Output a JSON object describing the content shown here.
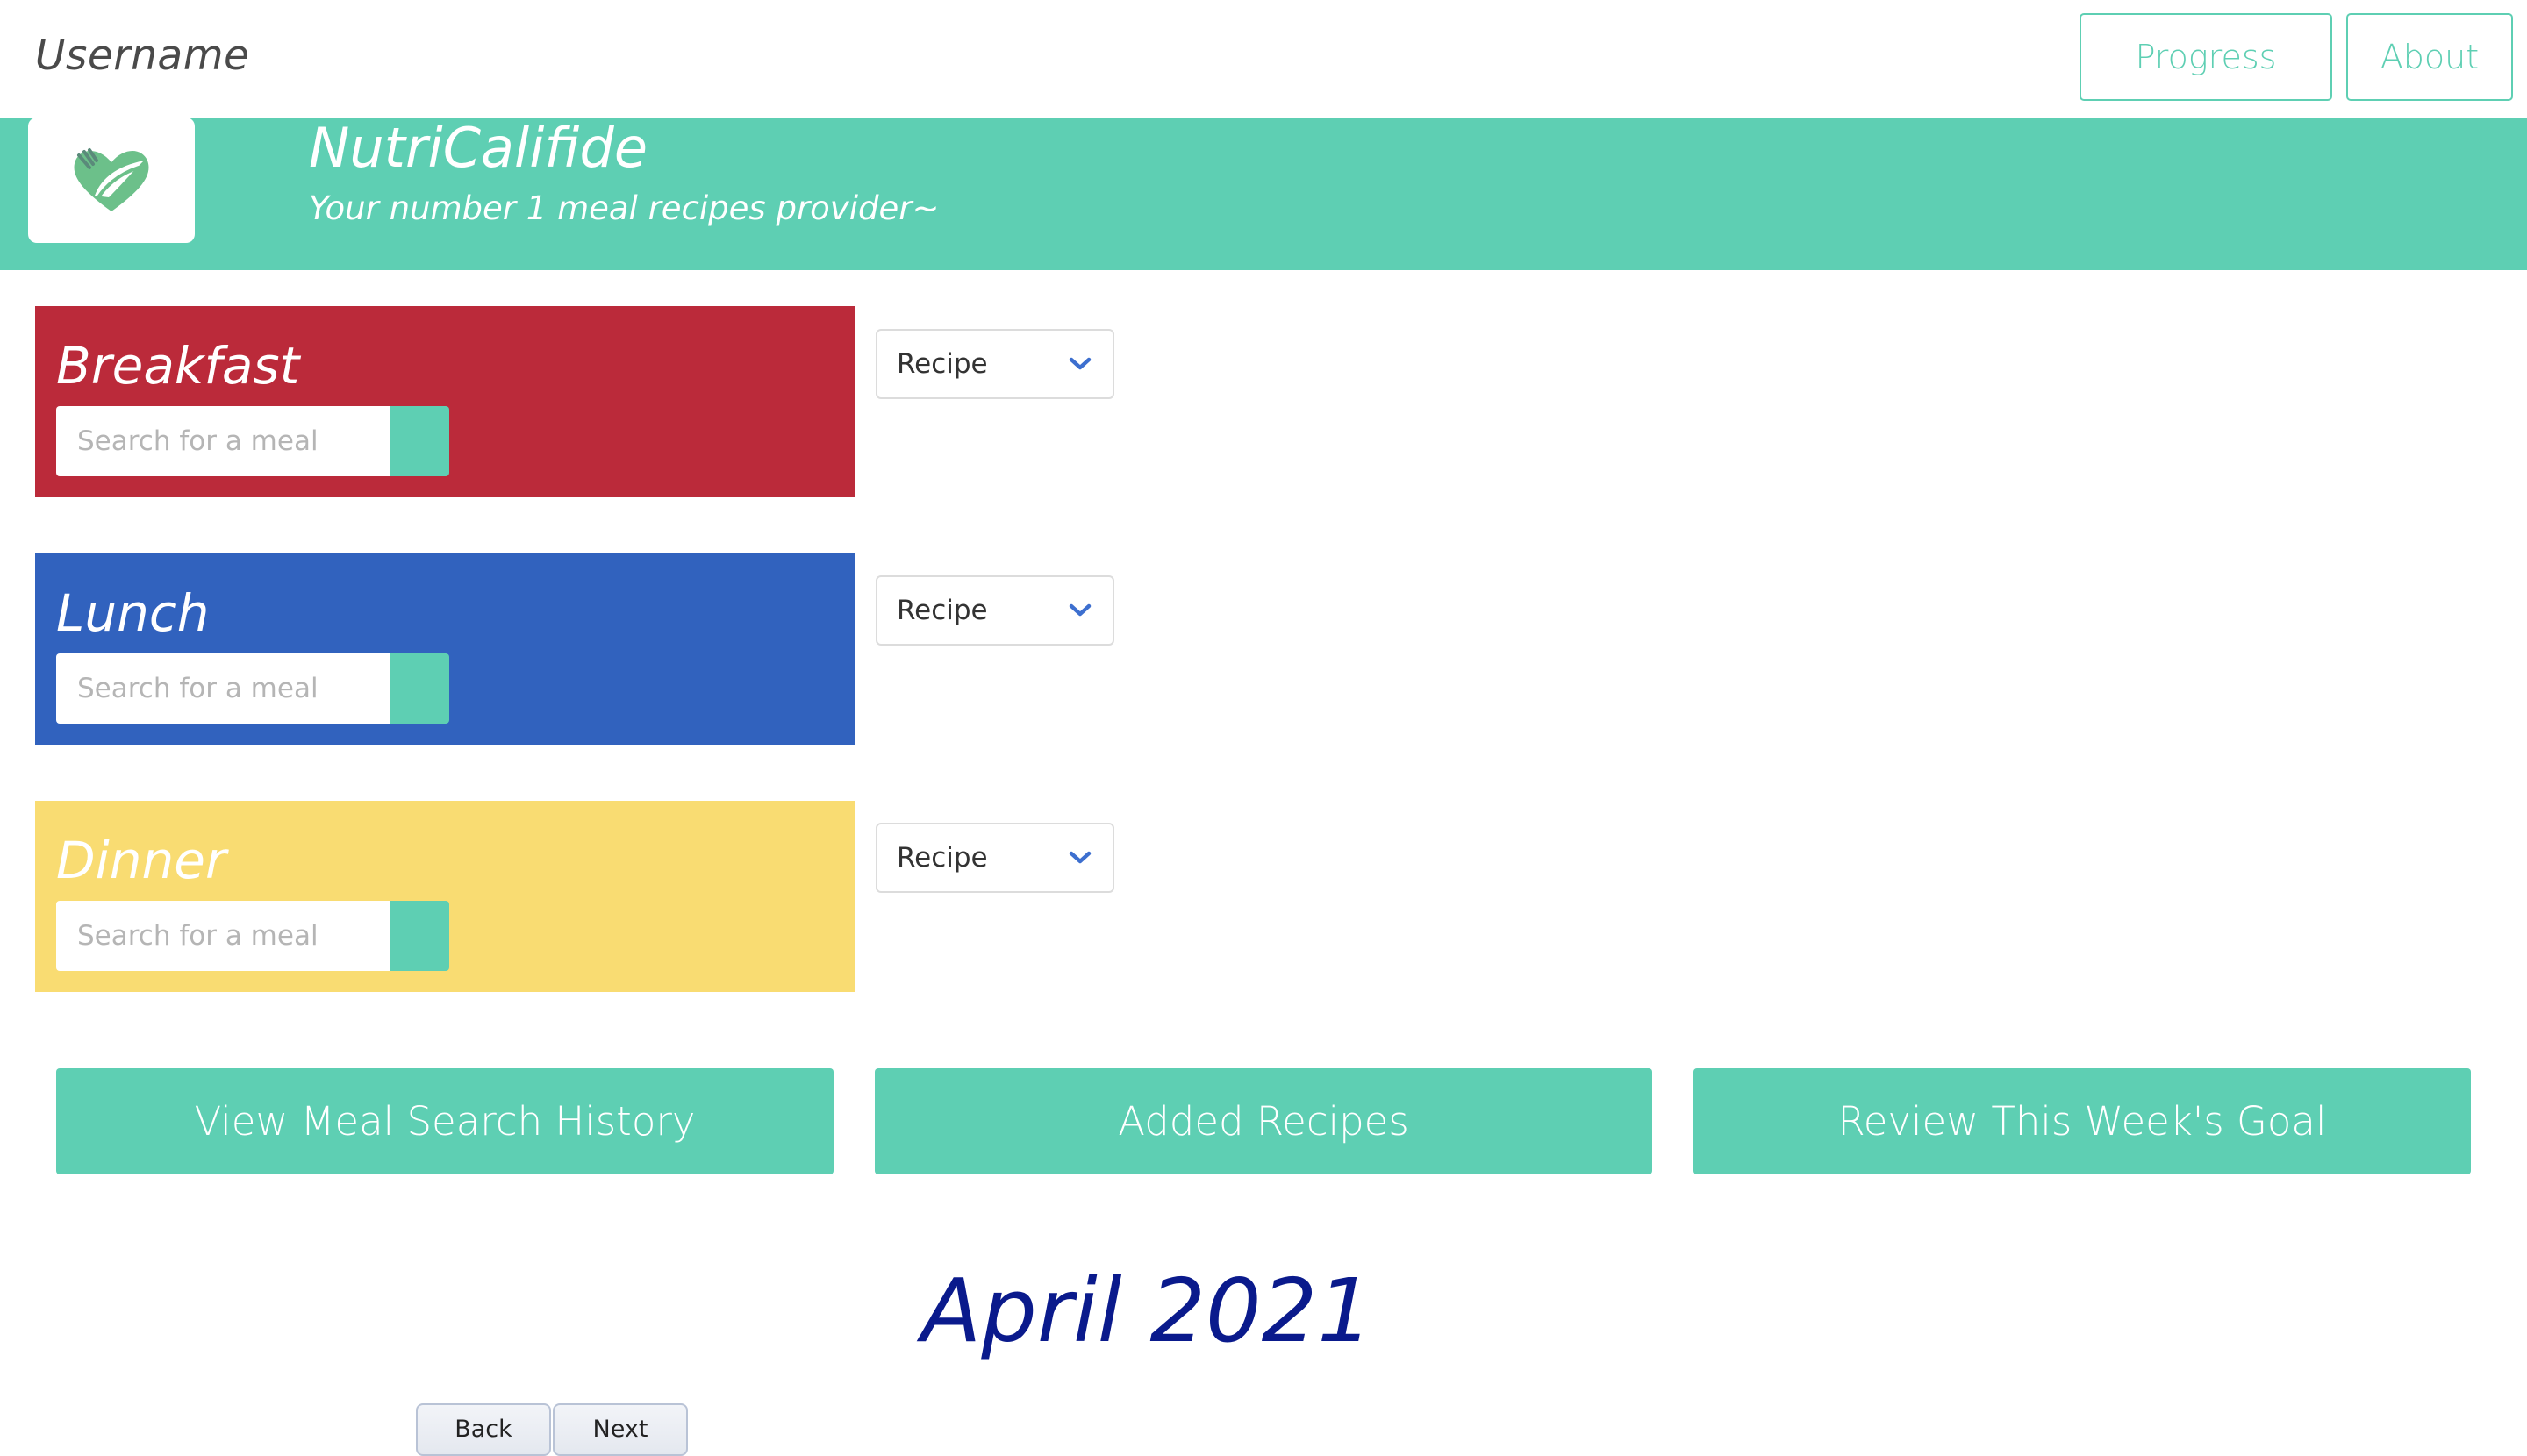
{
  "header": {
    "username": "Username",
    "nav": [
      {
        "label": "Progress"
      },
      {
        "label": "About"
      }
    ]
  },
  "brand": {
    "name": "NutriCalifide",
    "tagline": "Your number 1 meal recipes provider~",
    "logo_icon": "heart-leaf-icon"
  },
  "meals": [
    {
      "title": "Breakfast",
      "search_placeholder": "Search for a meal",
      "select_value": "Recipe",
      "color": "#bb2a3a"
    },
    {
      "title": "Lunch",
      "search_placeholder": "Search for a meal",
      "select_value": "Recipe",
      "color": "#3162be"
    },
    {
      "title": "Dinner",
      "search_placeholder": "Search for a meal",
      "select_value": "Recipe",
      "color": "#f9dc72"
    }
  ],
  "actions": [
    {
      "label": "View Meal Search History"
    },
    {
      "label": "Added Recipes"
    },
    {
      "label": "Review This Week's Goal"
    }
  ],
  "calendar": {
    "month_label": "April 2021",
    "back_label": "Back",
    "next_label": "Next"
  },
  "colors": {
    "accent": "#5ecfb3",
    "month_title": "#0a1a8c"
  }
}
